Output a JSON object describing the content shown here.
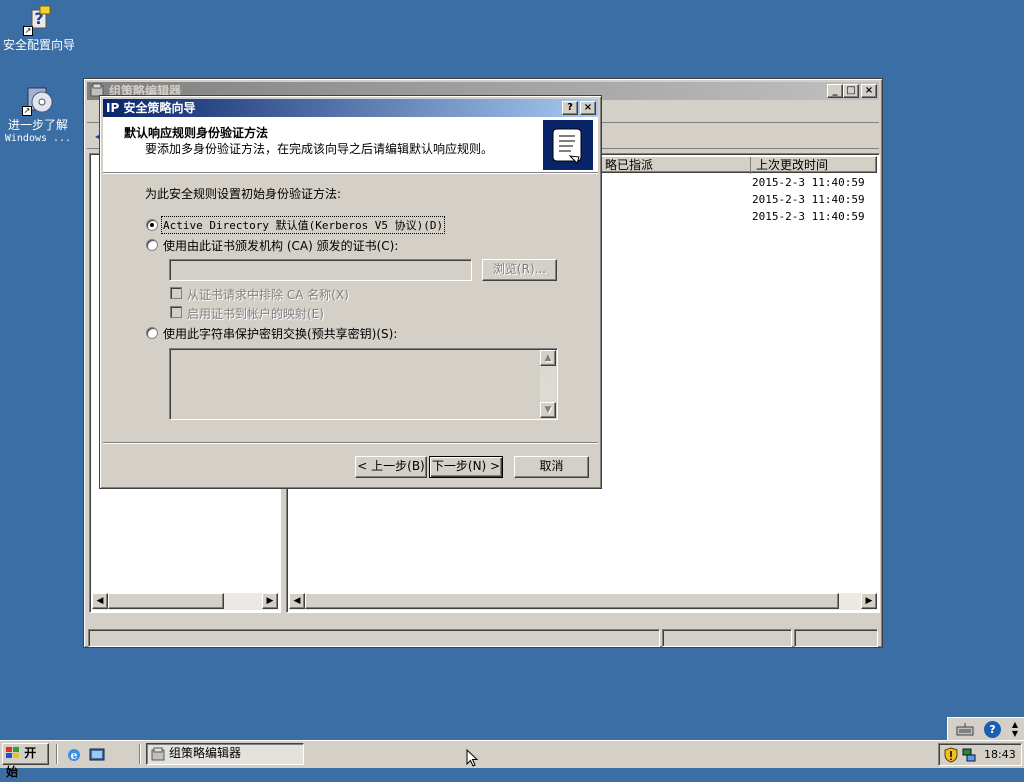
{
  "desktop": {
    "icons": [
      {
        "label": "安全配置向导"
      },
      {
        "label_line1": "进一步了解",
        "label_line2": "Windows ..."
      }
    ]
  },
  "gpe": {
    "title": "组策略编辑器",
    "columns": {
      "assigned": "略已指派",
      "modified": "上次更改时间"
    },
    "rows": [
      {
        "modified": "2015-2-3 11:40:59"
      },
      {
        "modified": "2015-2-3 11:40:59"
      },
      {
        "modified": "2015-2-3 11:40:59"
      }
    ]
  },
  "wizard": {
    "title": "IP 安全策略向导",
    "help": "?",
    "close": "×",
    "header_title": "默认响应规则身份验证方法",
    "header_subtitle": "要添加多身份验证方法，在完成该向导之后请编辑默认响应规则。",
    "prompt": "为此安全规则设置初始身份验证方法:",
    "option_ad": "Active Directory 默认值(Kerberos V5 协议)(D)",
    "option_ca": "使用由此证书颁发机构 (CA) 颁发的证书(C):",
    "browse": "浏览(R)...",
    "check_exclude_ca": "从证书请求中排除 CA 名称(X)",
    "check_enable_mapping": "启用证书到帐户的映射(E)",
    "option_psk": "使用此字符串保护密钥交换(预共享密钥)(S):",
    "back": "< 上一步(B)",
    "next": "下一步(N) >",
    "cancel": "取消"
  },
  "taskbar": {
    "start": "开始",
    "task": "组策略编辑器",
    "clock": "18:43"
  }
}
